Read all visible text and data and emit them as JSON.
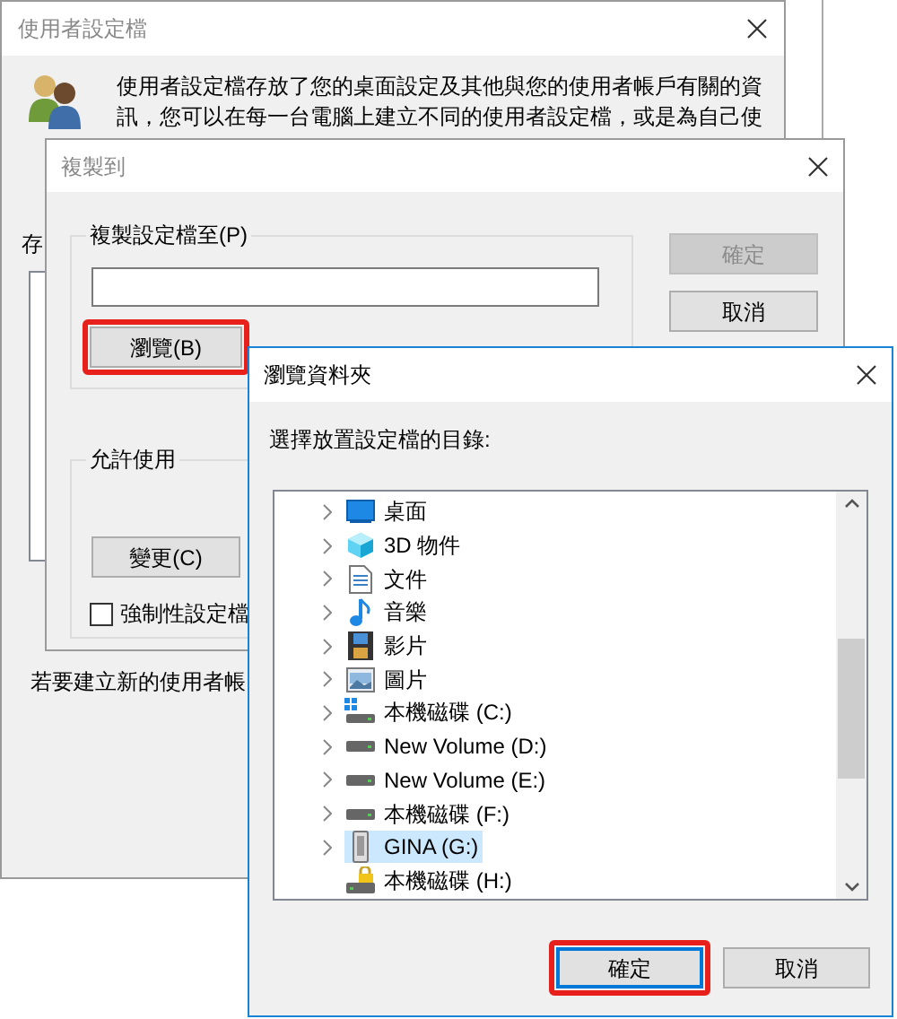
{
  "profile_window": {
    "title": "使用者設定檔",
    "description": [
      "使用者設定檔存放了您的桌面設定及其他與您的使用者帳戶有關的資",
      "訊，您可以在每一台電腦上建立不同的使用者設定檔，或是為自己使"
    ],
    "stored_label": "存",
    "footer": "若要建立新的使用者帳"
  },
  "copy_dialog": {
    "title": "複製到",
    "copy_group": {
      "label": "複製設定檔至(P)",
      "browse_button": {
        "label": "瀏覽(B)",
        "highlighted": true
      }
    },
    "buttons": [
      {
        "label": "確定",
        "disabled": true
      },
      {
        "label": "取消",
        "disabled": false
      }
    ],
    "permit_group": {
      "label": "允許使用",
      "change_button": {
        "label": "變更(C)"
      },
      "checkbox": {
        "label": "強制性設定檔",
        "checked": false
      }
    }
  },
  "browse_dialog": {
    "title": "瀏覽資料夾",
    "prompt": "選擇放置設定檔的目錄:",
    "tree": [
      {
        "label": "桌面",
        "kind": "desktop",
        "expandable": true,
        "selected": false
      },
      {
        "label": "3D 物件",
        "kind": "objects",
        "expandable": true,
        "selected": false
      },
      {
        "label": "文件",
        "kind": "document",
        "expandable": true,
        "selected": false
      },
      {
        "label": "音樂",
        "kind": "music",
        "expandable": true,
        "selected": false
      },
      {
        "label": "影片",
        "kind": "video",
        "expandable": true,
        "selected": false
      },
      {
        "label": "圖片",
        "kind": "picture",
        "expandable": true,
        "selected": false
      },
      {
        "label": "本機磁碟 (C:)",
        "kind": "system_drive",
        "expandable": true,
        "selected": false
      },
      {
        "label": "New Volume (D:)",
        "kind": "drive",
        "expandable": true,
        "selected": false
      },
      {
        "label": "New Volume (E:)",
        "kind": "drive",
        "expandable": true,
        "selected": false
      },
      {
        "label": "本機磁碟 (F:)",
        "kind": "drive",
        "expandable": true,
        "selected": false
      },
      {
        "label": "GINA (G:)",
        "kind": "usb",
        "expandable": true,
        "selected": true
      },
      {
        "label": "本機磁碟 (H:)",
        "kind": "locked_drive",
        "expandable": false,
        "selected": false
      }
    ],
    "buttons": [
      {
        "label": "確定",
        "highlighted": true,
        "focused": true
      },
      {
        "label": "取消",
        "highlighted": false,
        "focused": false
      }
    ]
  }
}
